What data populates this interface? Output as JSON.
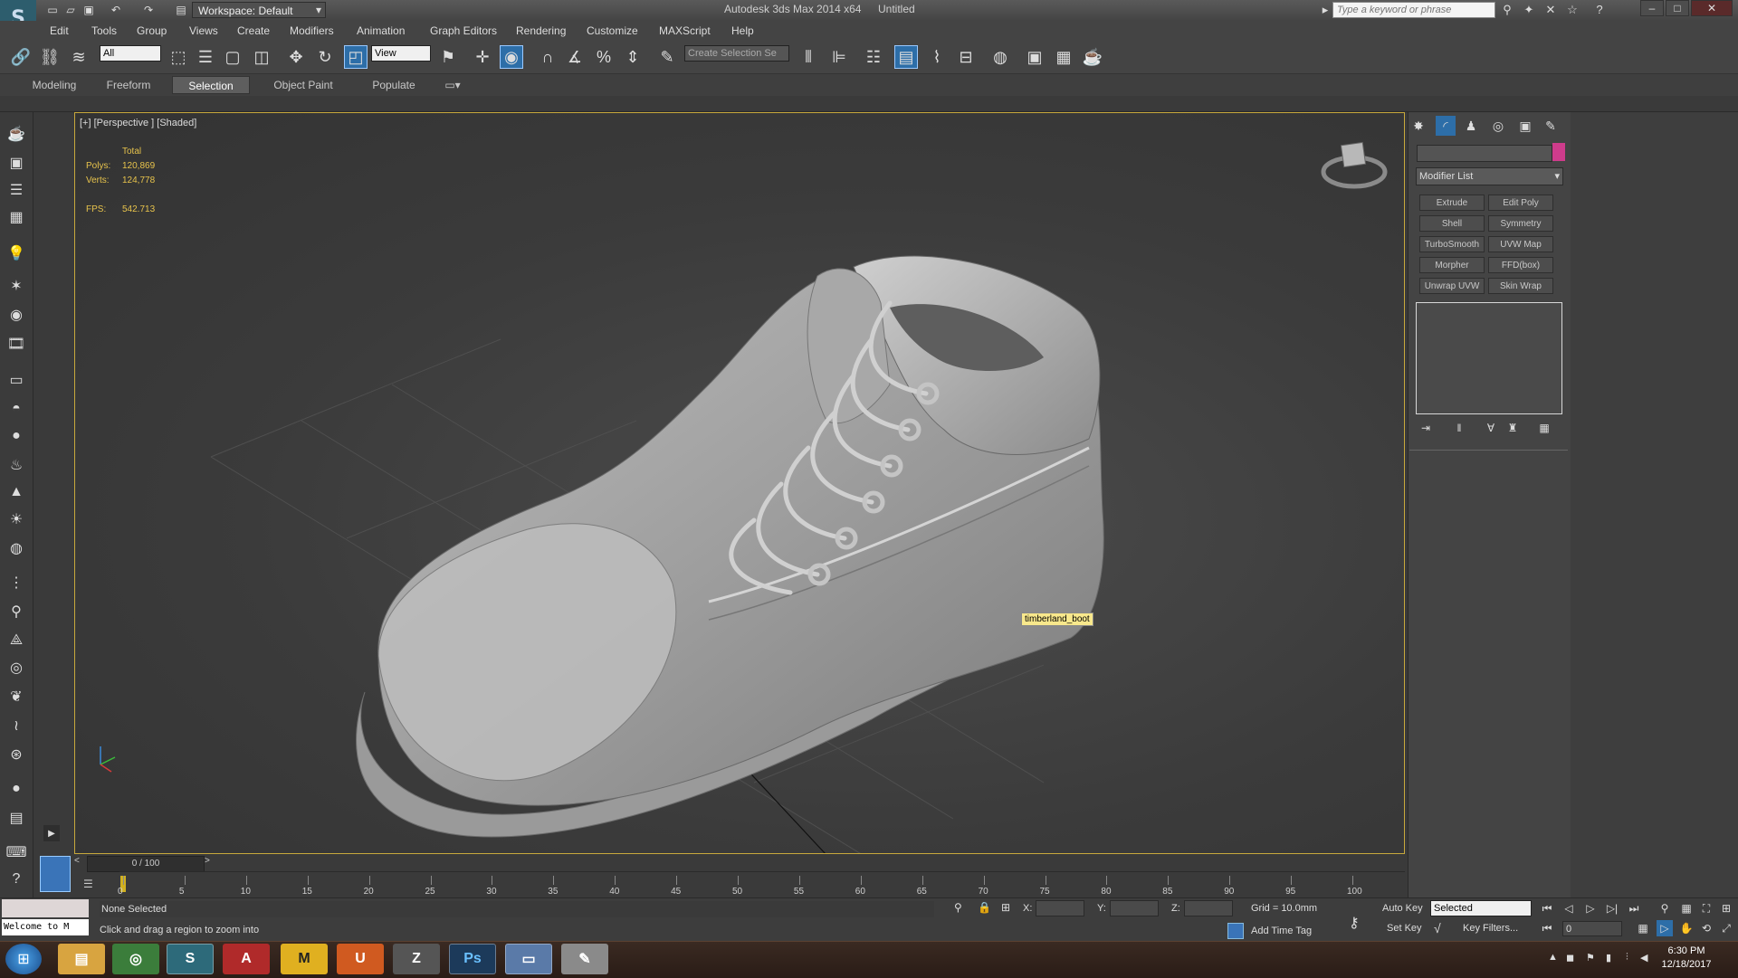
{
  "app": {
    "title": "Autodesk 3ds Max 2014 x64",
    "document": "Untitled",
    "workspace": "Workspace: Default",
    "search_placeholder": "Type a keyword or phrase"
  },
  "menus": [
    "Edit",
    "Tools",
    "Group",
    "Views",
    "Create",
    "Modifiers",
    "Animation",
    "Graph Editors",
    "Rendering",
    "Customize",
    "MAXScript",
    "Help"
  ],
  "toolbar": {
    "selection_filter": "All",
    "reference_coord": "View",
    "named_selection": "Create Selection Se"
  },
  "ribbon_tabs": [
    "Modeling",
    "Freeform",
    "Selection",
    "Object Paint",
    "Populate"
  ],
  "ribbon_active": "Selection",
  "viewport": {
    "label": "[+] [Perspective ] [Shaded]",
    "stats": {
      "header": "Total",
      "polys_label": "Polys:",
      "polys": "120,869",
      "verts_label": "Verts:",
      "verts": "124,778",
      "fps_label": "FPS:",
      "fps": "542.713"
    },
    "object_tooltip": "timberland_boot"
  },
  "command_panel": {
    "modifier_list": "Modifier List",
    "modifier_buttons": [
      "Extrude",
      "Edit Poly",
      "Shell",
      "Symmetry",
      "TurboSmooth",
      "UVW Map",
      "Morpher",
      "FFD(box)",
      "Unwrap UVW",
      "Skin Wrap"
    ],
    "object_color": "#cf3c8c"
  },
  "timeline": {
    "frame_label": "0 / 100",
    "ticks": [
      "0",
      "5",
      "10",
      "15",
      "20",
      "25",
      "30",
      "35",
      "40",
      "45",
      "50",
      "55",
      "60",
      "65",
      "70",
      "75",
      "80",
      "85",
      "90",
      "95",
      "100"
    ]
  },
  "status": {
    "selection": "None Selected",
    "prompt": "Click and drag a region to zoom into",
    "welcome": "Welcome to M",
    "x_label": "X:",
    "y_label": "Y:",
    "z_label": "Z:",
    "grid": "Grid = 10.0mm",
    "add_time_tag": "Add Time Tag",
    "auto_key": "Auto Key",
    "set_key": "Set Key",
    "key_mode": "Selected",
    "key_filters": "Key Filters...",
    "current_frame": "0"
  },
  "taskbar": {
    "time": "6:30 PM",
    "date": "12/18/2017",
    "apps": [
      "explorer",
      "chrome",
      "3dsmax",
      "autodesk",
      "mudbox",
      "substance",
      "zbrush",
      "photoshop",
      "window",
      "paint"
    ]
  }
}
